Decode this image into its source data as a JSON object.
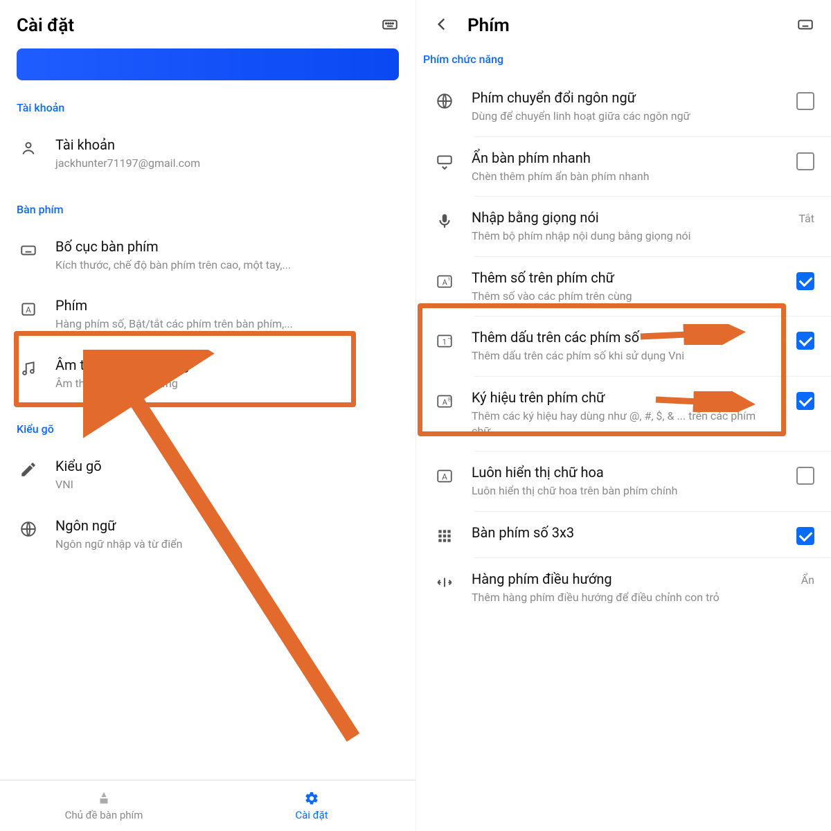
{
  "left": {
    "title": "Cài đặt",
    "sections": {
      "account": "Tài khoản",
      "keyboard": "Bàn phím",
      "typing": "Kiểu gõ"
    },
    "items": {
      "account": {
        "title": "Tài khoản",
        "sub": "jackhunter71197@gmail.com"
      },
      "layout": {
        "title": "Bố cục bàn phím",
        "sub": "Kích thước, chế độ bàn phím trên cao, một tay,..."
      },
      "keys": {
        "title": "Phím",
        "sub": "Hàng phím số, Bật/tắt các phím trên bàn phím,..."
      },
      "sound": {
        "title": "Âm thanh và hiệu ứng",
        "sub": "Âm thanh, rung, hiệu ứng"
      },
      "typing": {
        "title": "Kiểu gõ",
        "sub": "VNI"
      },
      "language": {
        "title": "Ngôn ngữ",
        "sub": "Ngôn ngữ nhập và từ điển"
      }
    },
    "nav": {
      "theme": "Chủ đề bàn phím",
      "settings": "Cài đặt"
    }
  },
  "right": {
    "title": "Phím",
    "section": "Phím chức năng",
    "items": {
      "lang": {
        "title": "Phím chuyển đổi ngôn ngữ",
        "sub": "Dùng để chuyển linh hoạt giữa các ngôn ngữ"
      },
      "hide": {
        "title": "Ẩn bàn phím nhanh",
        "sub": "Chèn thêm phím ẩn bàn phím nhanh"
      },
      "voice": {
        "title": "Nhập bằng giọng nói",
        "sub": "Thêm bộ phím nhập nội dung bằng giọng nói",
        "trail": "Tắt"
      },
      "numOnLetter": {
        "title": "Thêm số trên phím chữ",
        "sub": "Thêm số vào các phím trên cùng"
      },
      "accentOnNum": {
        "title": "Thêm dấu trên các phím số",
        "sub": "Thêm dấu trên các phím số khi sử dụng Vni"
      },
      "symbols": {
        "title": "Ký hiệu trên phím chữ",
        "sub": "Thêm các ký hiệu hay dùng như @, #, $, & ... trên các phím chữ"
      },
      "upper": {
        "title": "Luôn hiển thị chữ hoa",
        "sub": "Luôn hiển thị chữ hoa trên bàn phím chính"
      },
      "numpad": {
        "title": "Bàn phím số 3x3",
        "sub": ""
      },
      "navrow": {
        "title": "Hàng phím điều hướng",
        "sub": "Thêm hàng phím điều hướng để điều chỉnh con trỏ",
        "trail": "Ẩn"
      }
    }
  }
}
